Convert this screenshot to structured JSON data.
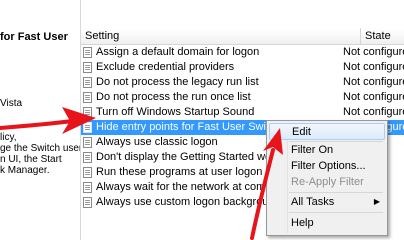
{
  "left_panel": {
    "title": "for Fast User",
    "lines": [
      "Vista",
      "licy,",
      "ge the Switch user",
      "n UI, the Start",
      "k Manager."
    ]
  },
  "header": {
    "setting": "Setting",
    "state": "State"
  },
  "rows": [
    {
      "name": "Assign a default domain for logon",
      "state": "Not configured"
    },
    {
      "name": "Exclude credential providers",
      "state": "Not configured"
    },
    {
      "name": "Do not process the legacy run list",
      "state": "Not configured"
    },
    {
      "name": "Do not process the run once list",
      "state": "Not configured"
    },
    {
      "name": "Turn off Windows Startup Sound",
      "state": "Not configured"
    },
    {
      "name": "Hide entry points for Fast User Switching",
      "state": "Not configured"
    },
    {
      "name": "Always use classic logon",
      "state": ""
    },
    {
      "name": "Don't display the Getting Started welcome",
      "state": ""
    },
    {
      "name": "Run these programs at user logon",
      "state": ""
    },
    {
      "name": "Always wait for the network at computer s",
      "state": ""
    },
    {
      "name": "Always use custom logon background",
      "state": ""
    }
  ],
  "context_menu": {
    "edit": "Edit",
    "filter_on": "Filter On",
    "filter_options": "Filter Options...",
    "reapply_filter": "Re-Apply Filter",
    "all_tasks": "All Tasks",
    "help": "Help"
  },
  "colors": {
    "selection": "#3399ff",
    "annotation_arrow": "#e8141c"
  }
}
